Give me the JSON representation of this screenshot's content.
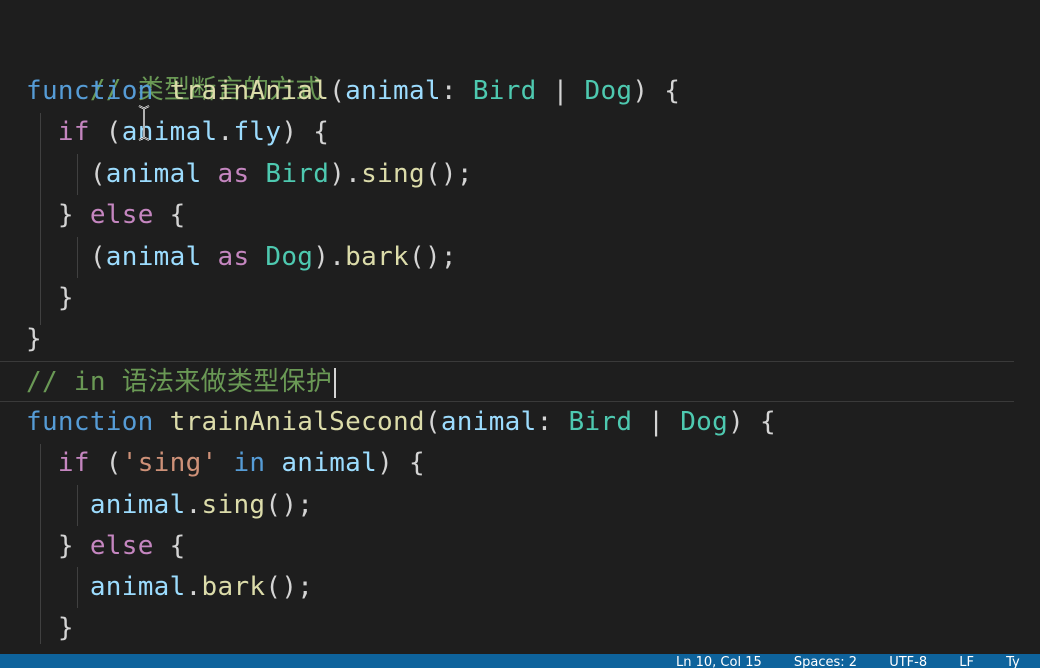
{
  "lines": {
    "l1": {
      "comment": "// 类型断言的方式"
    },
    "l2": {
      "kw": "function",
      "fn": "trainAnial",
      "p1": "(",
      "param": "animal",
      "p2": ": ",
      "t1": "Bird",
      "p3": " | ",
      "t2": "Dog",
      "p4": ") {"
    },
    "l3": {
      "kw": "if",
      "p1": " (",
      "obj": "animal",
      "p2": ".",
      "prop": "fly",
      "p3": ") {"
    },
    "l4": {
      "p1": "(",
      "obj": "animal",
      "as": " as ",
      "type": "Bird",
      "p2": ").",
      "method": "sing",
      "p3": "();"
    },
    "l5": {
      "p1": "} ",
      "kw": "else",
      "p2": " {"
    },
    "l6": {
      "p1": "(",
      "obj": "animal",
      "as": " as ",
      "type": "Dog",
      "p2": ").",
      "method": "bark",
      "p3": "();"
    },
    "l7": {
      "p1": "}"
    },
    "l8": {
      "p1": "}"
    },
    "l9": {
      "comment": "// in 语法来做类型保护"
    },
    "l10": {
      "kw": "function",
      "fn": "trainAnialSecond",
      "p1": "(",
      "param": "animal",
      "p2": ": ",
      "t1": "Bird",
      "p3": " | ",
      "t2": "Dog",
      "p4": ") {"
    },
    "l11": {
      "kw": "if",
      "p1": " (",
      "str": "'sing'",
      "in": " in ",
      "obj": "animal",
      "p2": ") {"
    },
    "l12": {
      "obj": "animal",
      "p1": ".",
      "method": "sing",
      "p2": "();"
    },
    "l13": {
      "p1": "} ",
      "kw": "else",
      "p2": " {"
    },
    "l14": {
      "obj": "animal",
      "p1": ".",
      "method": "bark",
      "p2": "();"
    },
    "l15": {
      "p1": "}"
    }
  },
  "statusbar": {
    "position": "Ln 10, Col 15",
    "spaces": "Spaces: 2",
    "encoding": "UTF-8",
    "eol": "LF",
    "language": "Ty"
  },
  "colors": {
    "background": "#1e1e1e",
    "comment": "#6a9955",
    "keyword": "#569cd6",
    "control": "#c586c0",
    "function": "#dcdcaa",
    "variable": "#9cdcfe",
    "type": "#4ec9b0",
    "string": "#ce9178",
    "statusbar": "#0e639c"
  }
}
